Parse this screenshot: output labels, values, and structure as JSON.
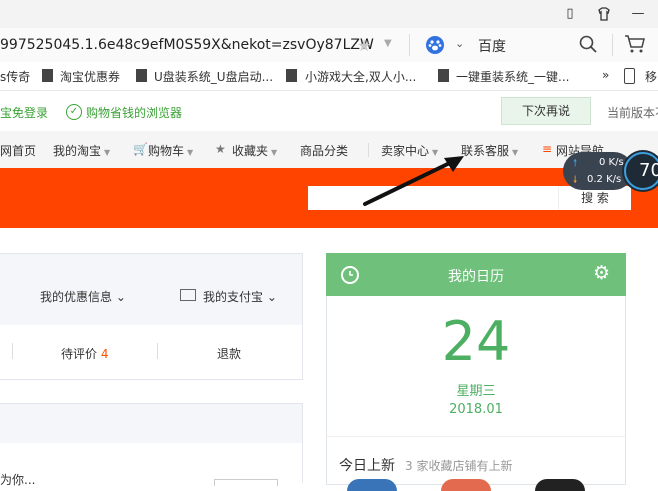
{
  "address_bar": {
    "url": "997525045.1.6e48c9efM0S59X&nekot=zsvOy87LZW",
    "search_engine": "百度"
  },
  "bookmarks": [
    "s传奇",
    "淘宝优惠券",
    "U盘装系统_U盘启动...",
    "小游戏大全,双人小...",
    "一键重装系统_一键...",
    "»",
    "移"
  ],
  "notice": {
    "left_text": "宝免登录",
    "message": "购物省钱的浏览器",
    "later_button": "下次再说",
    "current_version": "当前版本不"
  },
  "taobao_nav": {
    "items": [
      "网首页",
      "我的淘宝",
      "购物车",
      "收藏夹",
      "商品分类",
      "卖家中心",
      "联系客服",
      "网站导航"
    ]
  },
  "search": {
    "button": "搜 索"
  },
  "speed_widget": {
    "up": "0 K/s",
    "down": "0.2 K/s",
    "percent": "70"
  },
  "account": {
    "coupon": "我的优惠信息",
    "alipay": "我的支付宝",
    "to_review_label": "待评价",
    "to_review_count": "4",
    "refund": "退款",
    "for_you": "为你..."
  },
  "calendar": {
    "title": "我的日历",
    "day": "24",
    "weekday": "星期三",
    "month": "2018.01",
    "today_new": "今日上新",
    "today_new_detail": "3 家收藏店铺有上新"
  },
  "colors": {
    "taobao_orange": "#ff4400",
    "calendar_green": "#6ec07a",
    "notice_green": "#3aa335",
    "review_count": "#ff5000"
  }
}
